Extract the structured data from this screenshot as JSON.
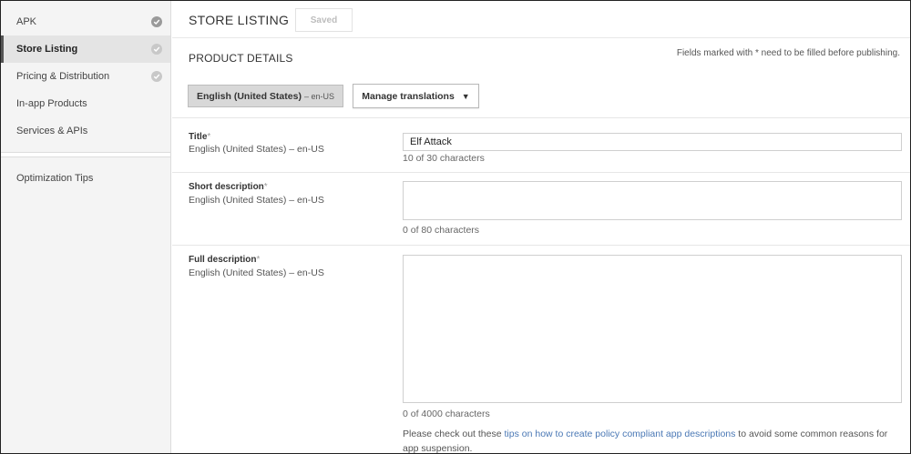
{
  "sidebar": {
    "items": [
      {
        "label": "APK",
        "checked": true
      },
      {
        "label": "Store Listing",
        "checked": true,
        "active": true
      },
      {
        "label": "Pricing & Distribution",
        "checked": true
      },
      {
        "label": "In-app Products"
      },
      {
        "label": "Services & APIs"
      },
      {
        "label": "Optimization Tips"
      }
    ]
  },
  "header": {
    "title": "STORE LISTING",
    "saved_label": "Saved"
  },
  "product_details": {
    "title": "PRODUCT DETAILS",
    "publish_note": "Fields marked with * need to be filled before publishing.",
    "language_button": "English (United States)",
    "language_code": "– en-US",
    "manage_translations_label": "Manage translations",
    "fields": {
      "title": {
        "label": "Title",
        "required_mark": "*",
        "language": "English (United States) – en-US",
        "value": "Elf Attack",
        "counter": "10 of 30 characters"
      },
      "short_description": {
        "label": "Short description",
        "required_mark": "*",
        "language": "English (United States) – en-US",
        "value": "",
        "counter": "0 of 80 characters"
      },
      "full_description": {
        "label": "Full description",
        "required_mark": "*",
        "language": "English (United States) – en-US",
        "value": "",
        "counter": "0 of 4000 characters"
      }
    },
    "policy_text_before": "Please check out these ",
    "policy_link": "tips on how to create policy compliant app descriptions",
    "policy_text_after": " to avoid some common reasons for app suspension."
  },
  "colors": {
    "sidebar_bg": "#f4f4f4",
    "active_item_bg": "#e4e4e4",
    "link": "#4a78b5",
    "check_dark": "#9a9a9a",
    "check_light": "#c8c8c8"
  }
}
